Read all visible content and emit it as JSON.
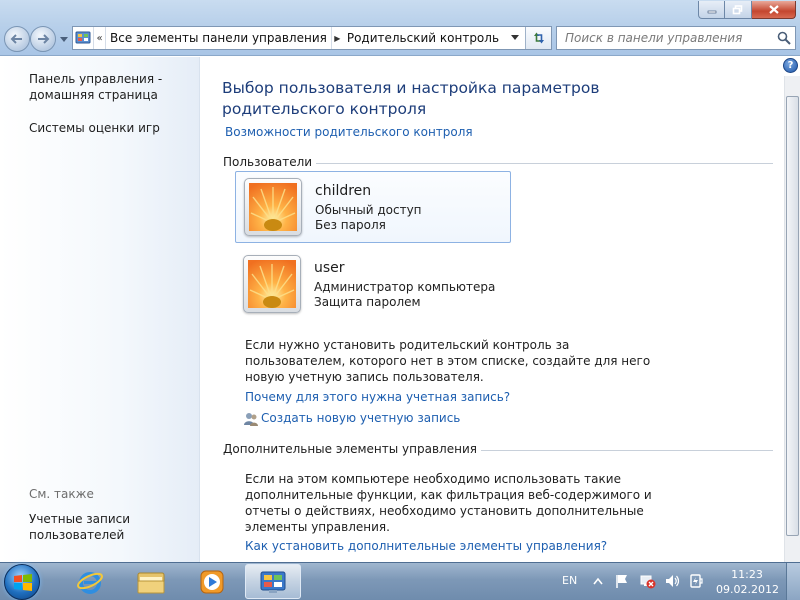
{
  "window": {
    "minimize_label": "minimize",
    "maximize_label": "maximize",
    "close_label": "close"
  },
  "address_bar": {
    "overflow_glyph": "«",
    "crumbs": [
      "Все элементы панели управления",
      "Родительский контроль"
    ]
  },
  "search": {
    "placeholder": "Поиск в панели управления"
  },
  "sidebar": {
    "home_link": "Панель управления - домашняя страница",
    "games_link": "Системы оценки игр",
    "see_also": "См. также",
    "accounts_link": "Учетные записи пользователей"
  },
  "main": {
    "title": "Выбор пользователя и настройка параметров родительского контроля",
    "features_link": "Возможности родительского контроля",
    "users_section": "Пользователи",
    "users": [
      {
        "name": "children",
        "role": "Обычный доступ",
        "password": "Без пароля"
      },
      {
        "name": "user",
        "role": "Администратор компьютера",
        "password": "Защита паролем"
      }
    ],
    "create_hint": "Если нужно установить родительский контроль за пользователем, которого нет в этом списке, создайте для него новую учетную запись пользователя.",
    "why_link": "Почему для этого нужна учетная запись?",
    "create_link": "Создать новую учетную запись",
    "extra_section": "Дополнительные элементы управления",
    "extra_hint": "Если на этом компьютере необходимо использовать такие дополнительные функции, как фильтрация веб-содержимого и отчеты о действиях, необходимо установить дополнительные элементы управления.",
    "howto_link": "Как установить дополнительные элементы управления?"
  },
  "taskbar": {
    "language": "EN",
    "time": "11:23",
    "date": "09.02.2012"
  },
  "colors": {
    "link": "#1e5fb0",
    "title": "#1d3d7a",
    "taskbar": "#7d98b7"
  }
}
